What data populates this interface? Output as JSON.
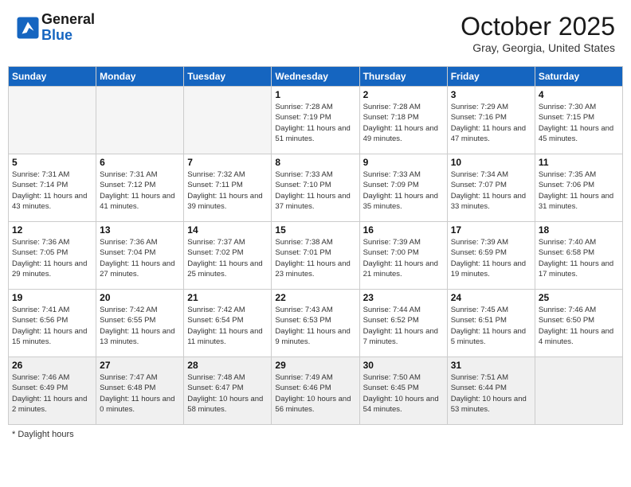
{
  "header": {
    "logo_line1": "General",
    "logo_line2": "Blue",
    "month": "October 2025",
    "location": "Gray, Georgia, United States"
  },
  "days_of_week": [
    "Sunday",
    "Monday",
    "Tuesday",
    "Wednesday",
    "Thursday",
    "Friday",
    "Saturday"
  ],
  "weeks": [
    [
      {
        "day": "",
        "empty": true
      },
      {
        "day": "",
        "empty": true
      },
      {
        "day": "",
        "empty": true
      },
      {
        "day": "1",
        "sunrise": "7:28 AM",
        "sunset": "7:19 PM",
        "daylight": "11 hours and 51 minutes."
      },
      {
        "day": "2",
        "sunrise": "7:28 AM",
        "sunset": "7:18 PM",
        "daylight": "11 hours and 49 minutes."
      },
      {
        "day": "3",
        "sunrise": "7:29 AM",
        "sunset": "7:16 PM",
        "daylight": "11 hours and 47 minutes."
      },
      {
        "day": "4",
        "sunrise": "7:30 AM",
        "sunset": "7:15 PM",
        "daylight": "11 hours and 45 minutes."
      }
    ],
    [
      {
        "day": "5",
        "sunrise": "7:31 AM",
        "sunset": "7:14 PM",
        "daylight": "11 hours and 43 minutes."
      },
      {
        "day": "6",
        "sunrise": "7:31 AM",
        "sunset": "7:12 PM",
        "daylight": "11 hours and 41 minutes."
      },
      {
        "day": "7",
        "sunrise": "7:32 AM",
        "sunset": "7:11 PM",
        "daylight": "11 hours and 39 minutes."
      },
      {
        "day": "8",
        "sunrise": "7:33 AM",
        "sunset": "7:10 PM",
        "daylight": "11 hours and 37 minutes."
      },
      {
        "day": "9",
        "sunrise": "7:33 AM",
        "sunset": "7:09 PM",
        "daylight": "11 hours and 35 minutes."
      },
      {
        "day": "10",
        "sunrise": "7:34 AM",
        "sunset": "7:07 PM",
        "daylight": "11 hours and 33 minutes."
      },
      {
        "day": "11",
        "sunrise": "7:35 AM",
        "sunset": "7:06 PM",
        "daylight": "11 hours and 31 minutes."
      }
    ],
    [
      {
        "day": "12",
        "sunrise": "7:36 AM",
        "sunset": "7:05 PM",
        "daylight": "11 hours and 29 minutes."
      },
      {
        "day": "13",
        "sunrise": "7:36 AM",
        "sunset": "7:04 PM",
        "daylight": "11 hours and 27 minutes."
      },
      {
        "day": "14",
        "sunrise": "7:37 AM",
        "sunset": "7:02 PM",
        "daylight": "11 hours and 25 minutes."
      },
      {
        "day": "15",
        "sunrise": "7:38 AM",
        "sunset": "7:01 PM",
        "daylight": "11 hours and 23 minutes."
      },
      {
        "day": "16",
        "sunrise": "7:39 AM",
        "sunset": "7:00 PM",
        "daylight": "11 hours and 21 minutes."
      },
      {
        "day": "17",
        "sunrise": "7:39 AM",
        "sunset": "6:59 PM",
        "daylight": "11 hours and 19 minutes."
      },
      {
        "day": "18",
        "sunrise": "7:40 AM",
        "sunset": "6:58 PM",
        "daylight": "11 hours and 17 minutes."
      }
    ],
    [
      {
        "day": "19",
        "sunrise": "7:41 AM",
        "sunset": "6:56 PM",
        "daylight": "11 hours and 15 minutes."
      },
      {
        "day": "20",
        "sunrise": "7:42 AM",
        "sunset": "6:55 PM",
        "daylight": "11 hours and 13 minutes."
      },
      {
        "day": "21",
        "sunrise": "7:42 AM",
        "sunset": "6:54 PM",
        "daylight": "11 hours and 11 minutes."
      },
      {
        "day": "22",
        "sunrise": "7:43 AM",
        "sunset": "6:53 PM",
        "daylight": "11 hours and 9 minutes."
      },
      {
        "day": "23",
        "sunrise": "7:44 AM",
        "sunset": "6:52 PM",
        "daylight": "11 hours and 7 minutes."
      },
      {
        "day": "24",
        "sunrise": "7:45 AM",
        "sunset": "6:51 PM",
        "daylight": "11 hours and 5 minutes."
      },
      {
        "day": "25",
        "sunrise": "7:46 AM",
        "sunset": "6:50 PM",
        "daylight": "11 hours and 4 minutes."
      }
    ],
    [
      {
        "day": "26",
        "sunrise": "7:46 AM",
        "sunset": "6:49 PM",
        "daylight": "11 hours and 2 minutes."
      },
      {
        "day": "27",
        "sunrise": "7:47 AM",
        "sunset": "6:48 PM",
        "daylight": "11 hours and 0 minutes."
      },
      {
        "day": "28",
        "sunrise": "7:48 AM",
        "sunset": "6:47 PM",
        "daylight": "10 hours and 58 minutes."
      },
      {
        "day": "29",
        "sunrise": "7:49 AM",
        "sunset": "6:46 PM",
        "daylight": "10 hours and 56 minutes."
      },
      {
        "day": "30",
        "sunrise": "7:50 AM",
        "sunset": "6:45 PM",
        "daylight": "10 hours and 54 minutes."
      },
      {
        "day": "31",
        "sunrise": "7:51 AM",
        "sunset": "6:44 PM",
        "daylight": "10 hours and 53 minutes."
      },
      {
        "day": "",
        "empty": true
      }
    ]
  ],
  "footer": {
    "note": "Daylight hours"
  }
}
